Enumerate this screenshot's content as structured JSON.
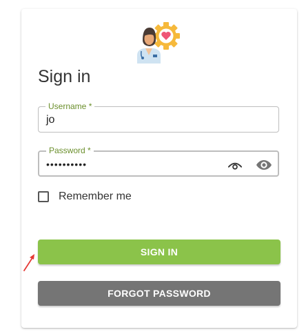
{
  "login": {
    "title": "Sign in",
    "username": {
      "label": "Username *",
      "value": "jo"
    },
    "password": {
      "label": "Password *",
      "value": "••••••••••"
    },
    "remember_label": "Remember me",
    "remember_checked": false,
    "signin_label": "SIGN IN",
    "forgot_label": "FORGOT PASSWORD"
  },
  "colors": {
    "accent": "#8bc34a",
    "label_green": "#6b8f2c",
    "secondary_button": "#757575",
    "annotation_arrow": "#e53935"
  },
  "icons": [
    "doctor-heart-logo-icon",
    "eye-outline-icon",
    "eye-icon",
    "red-pointer-arrow"
  ]
}
